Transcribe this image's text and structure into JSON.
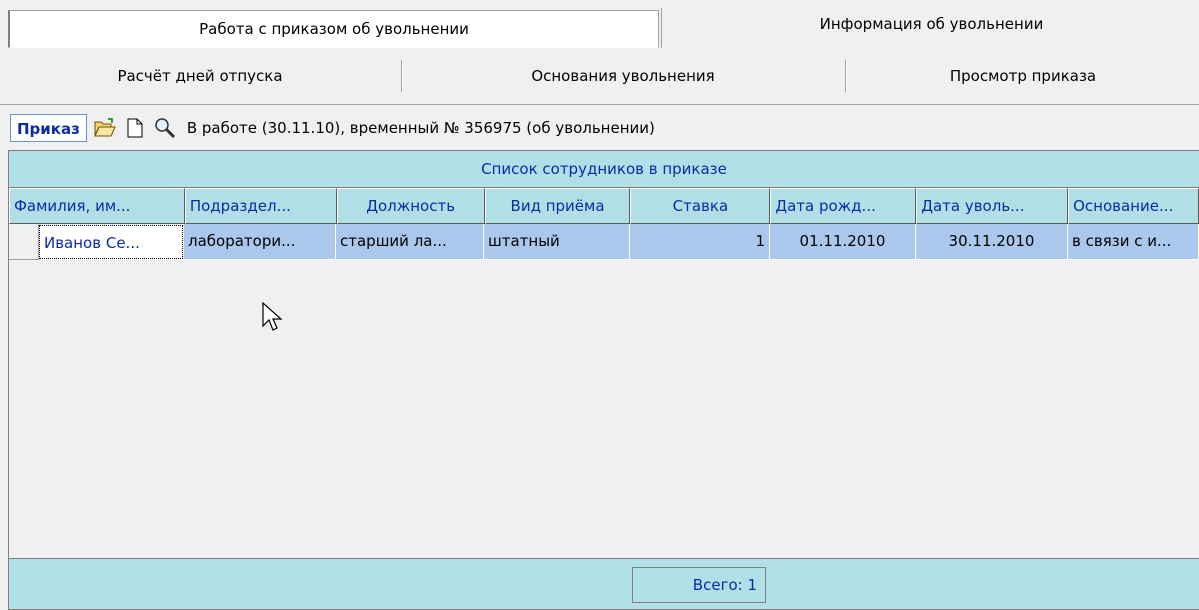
{
  "tabs_top": [
    {
      "label": "Работа с приказом об увольнении",
      "active": false
    },
    {
      "label": "Информация об увольнении",
      "active": true
    }
  ],
  "tabs_sub": [
    {
      "label": "Расчёт дней отпуска"
    },
    {
      "label": "Основания увольнения"
    },
    {
      "label": "Просмотр приказа"
    }
  ],
  "order": {
    "label": "Приказ",
    "status": "В работе (30.11.10), временный № 356975 (об увольнении)",
    "icons": [
      "open-folder-icon",
      "new-document-icon",
      "search-icon"
    ]
  },
  "grid": {
    "caption": "Список сотрудников в приказе",
    "columns": [
      "Фамилия, им...",
      "Подраздел...",
      "Должность",
      "Вид приёма",
      "Ставка",
      "Дата рожд...",
      "Дата уволь...",
      "Основание..."
    ],
    "rows": [
      [
        "Иванов Се...",
        "лаборатори...",
        "старший ла...",
        "штатный",
        "1",
        "01.11.2010",
        "30.11.2010",
        "в связи с и..."
      ]
    ],
    "total": "Всего: 1"
  },
  "colors": {
    "accent_text": "#0a2aa8",
    "header_bg": "#b0e0e6",
    "selection_bg": "#a9c8ec"
  }
}
